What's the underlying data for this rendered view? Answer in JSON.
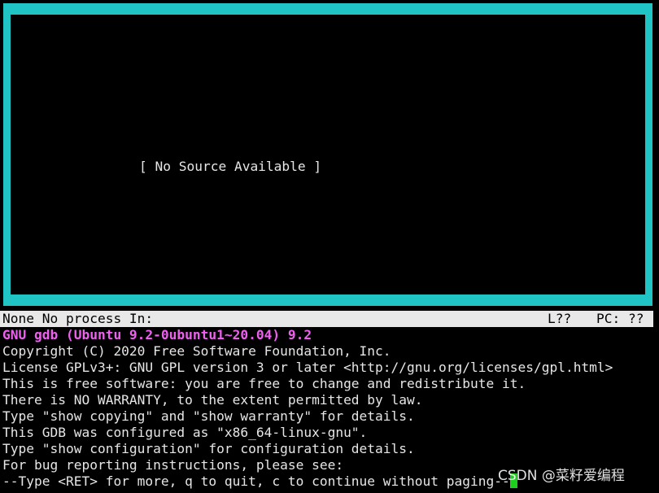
{
  "source_window": {
    "message": "[ No Source Available ]"
  },
  "status_bar": {
    "left": "None No process In:",
    "line": "L??",
    "pc": "PC: ??"
  },
  "console": {
    "banner": "GNU gdb (Ubuntu 9.2-0ubuntu1~20.04) 9.2",
    "lines": [
      "Copyright (C) 2020 Free Software Foundation, Inc.",
      "License GPLv3+: GNU GPL version 3 or later <http://gnu.org/licenses/gpl.html>",
      "This is free software: you are free to change and redistribute it.",
      "There is NO WARRANTY, to the extent permitted by law.",
      "Type \"show copying\" and \"show warranty\" for details.",
      "This GDB was configured as \"x86_64-linux-gnu\".",
      "Type \"show configuration\" for configuration details.",
      "For bug reporting instructions, please see:",
      "--Type <RET> for more, q to quit, c to continue without paging--"
    ]
  },
  "watermark": "CSDN @菜籽爱编程",
  "colors": {
    "window_border": "#20c4c4",
    "banner": "#f060f0",
    "cursor": "#1ed01e",
    "status_bar_bg": "#e8e8e8",
    "background": "#000000"
  }
}
